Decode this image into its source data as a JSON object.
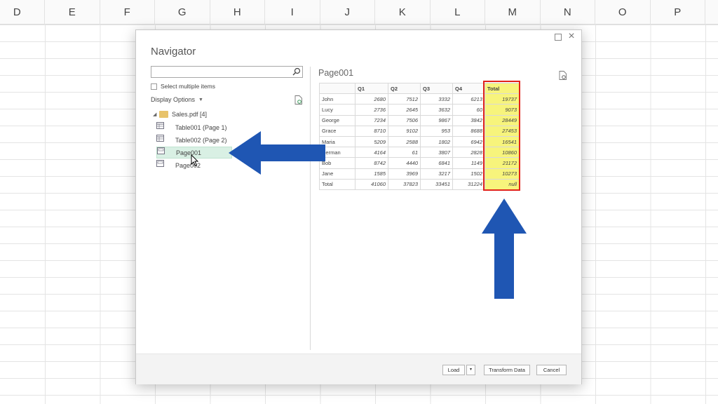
{
  "columns": [
    "D",
    "E",
    "F",
    "G",
    "H",
    "I",
    "J",
    "K",
    "L",
    "M",
    "N",
    "O",
    "P"
  ],
  "dialog": {
    "title": "Navigator",
    "search": {
      "value": "",
      "placeholder": ""
    },
    "select_multiple_label": "Select multiple items",
    "display_options_label": "Display Options",
    "tree": {
      "folder_label": "Sales.pdf [4]",
      "items": [
        {
          "label": "Table001 (Page 1)",
          "icon": "table-icon"
        },
        {
          "label": "Table002 (Page 2)",
          "icon": "table-icon"
        },
        {
          "label": "Page001",
          "icon": "page-icon",
          "selected": true
        },
        {
          "label": "Page002",
          "icon": "page-icon"
        }
      ]
    },
    "preview": {
      "title": "Page001",
      "headers": [
        "",
        "Q1",
        "Q2",
        "Q3",
        "Q4",
        "Total"
      ],
      "rows": [
        [
          "John",
          "2680",
          "7512",
          "3332",
          "6213",
          "19737"
        ],
        [
          "Lucy",
          "2736",
          "2645",
          "3632",
          "60",
          "9073"
        ],
        [
          "George",
          "7234",
          "7506",
          "9867",
          "3842",
          "28449"
        ],
        [
          "Grace",
          "8710",
          "9102",
          "953",
          "8688",
          "27453"
        ],
        [
          "Maria",
          "5209",
          "2588",
          "1802",
          "6942",
          "16541"
        ],
        [
          "Herman",
          "4164",
          "61",
          "3807",
          "2828",
          "10860"
        ],
        [
          "Bob",
          "8742",
          "4440",
          "6841",
          "1149",
          "21172"
        ],
        [
          "Jane",
          "1585",
          "3969",
          "3217",
          "1502",
          "10273"
        ],
        [
          "Total",
          "41060",
          "37823",
          "33451",
          "31224",
          "null"
        ]
      ]
    },
    "footer": {
      "load_label": "Load",
      "load_dropdown": "▾",
      "transform_label": "Transform Data",
      "cancel_label": "Cancel"
    }
  },
  "colors": {
    "arrow": "#1f56b3",
    "highlight": "#f7f47c",
    "highlight_border": "#e2231a",
    "selected_row": "#d9f0e4"
  }
}
